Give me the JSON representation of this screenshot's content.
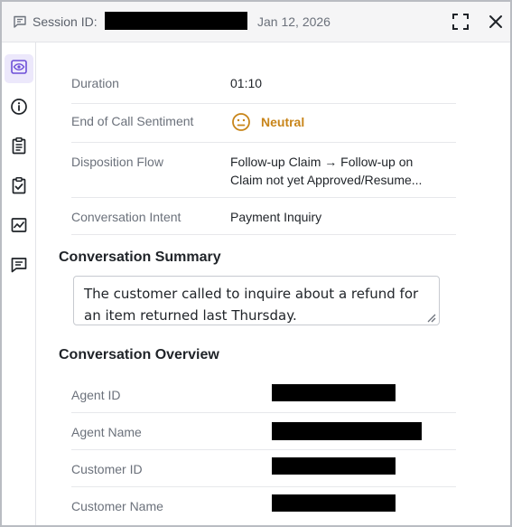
{
  "header": {
    "session_label": "Session ID:",
    "date": "Jan 12, 2026"
  },
  "sidebar": {
    "items": [
      {
        "name": "overview",
        "icon": "eye-icon",
        "active": true
      },
      {
        "name": "info",
        "icon": "info-icon",
        "active": false
      },
      {
        "name": "transcript",
        "icon": "clipboard-icon",
        "active": false
      },
      {
        "name": "checklist",
        "icon": "clipboard-check-icon",
        "active": false
      },
      {
        "name": "analytics",
        "icon": "chart-icon",
        "active": false
      },
      {
        "name": "comments",
        "icon": "comment-icon",
        "active": false
      }
    ]
  },
  "details": {
    "duration_label": "Duration",
    "duration_value": "01:10",
    "sentiment_label": "End of Call Sentiment",
    "sentiment_value": "Neutral",
    "flow_label": "Disposition Flow",
    "flow_line1": "Follow-up Claim → Follow-up on",
    "flow_line2": "Claim not yet Approved/Resume...",
    "intent_label": "Conversation Intent",
    "intent_value": "Payment Inquiry"
  },
  "summary": {
    "title": "Conversation Summary",
    "text": "The customer called to inquire about a refund for an item returned last Thursday."
  },
  "overview": {
    "title": "Conversation Overview",
    "agent_id_label": "Agent ID",
    "agent_name_label": "Agent Name",
    "customer_id_label": "Customer ID",
    "customer_name_label": "Customer Name"
  },
  "colors": {
    "accent": "#6d4fd8",
    "sentiment_neutral": "#c8851a",
    "text_muted": "#6b717b",
    "header_bg": "#f5f5f6"
  }
}
